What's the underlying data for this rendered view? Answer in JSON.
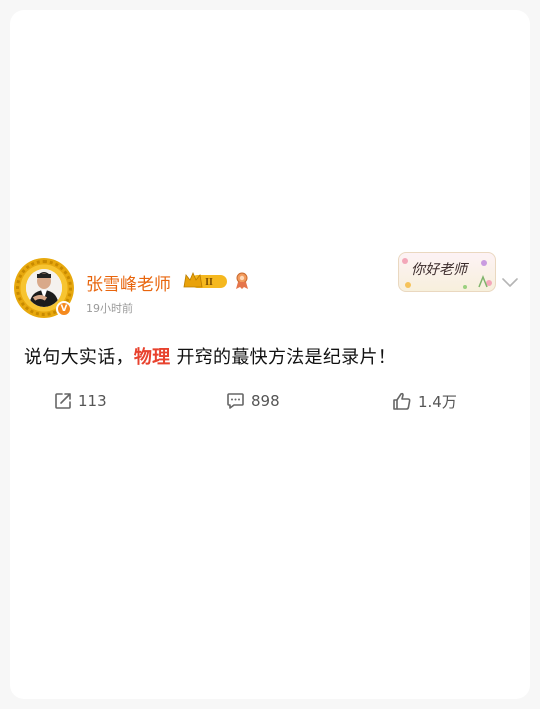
{
  "user": {
    "name": "张雪峰老师",
    "vip_level": "II",
    "verified_mark": "V"
  },
  "post": {
    "time": "19小时前",
    "text_before": "说句大实话，",
    "text_highlight": "物理",
    "text_after": " 开窍的蕞快方法是纪录片！"
  },
  "sticker": {
    "text": "你好老师"
  },
  "actions": {
    "reposts": "113",
    "comments": "898",
    "likes": "1.4万"
  },
  "colors": {
    "username": "#e8650d",
    "highlight": "#e8422e",
    "badge_gold": "#f5b81f"
  },
  "icons": {
    "repost": "share-icon",
    "comment": "comment-icon",
    "like": "thumbs-up-icon",
    "menu": "chevron-down-icon",
    "medal": "medal-icon"
  }
}
